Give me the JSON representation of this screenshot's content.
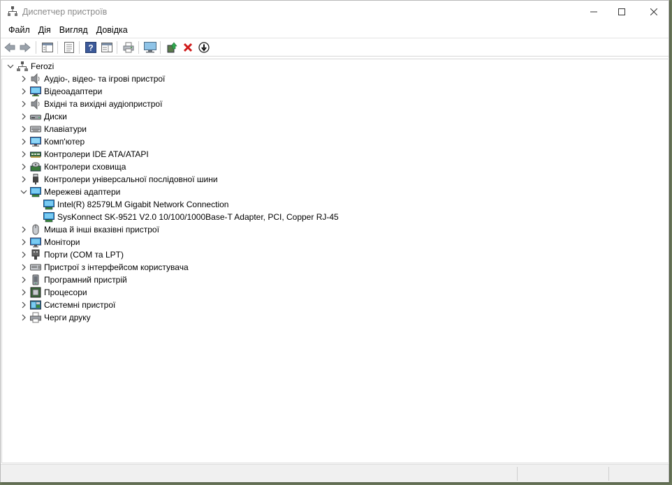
{
  "window": {
    "title": "Диспетчер пристроїв"
  },
  "menu": [
    {
      "label": "Файл"
    },
    {
      "label": "Дія"
    },
    {
      "label": "Вигляд"
    },
    {
      "label": "Довідка"
    }
  ],
  "tree": {
    "root": "Ferozi",
    "categories": [
      {
        "label": "Аудіо-, відео- та ігрові пристрої",
        "icon": "speaker-icon"
      },
      {
        "label": "Відеоадаптери",
        "icon": "display-adapter-icon"
      },
      {
        "label": "Вхідні та вихідні аудіопристрої",
        "icon": "speaker-icon"
      },
      {
        "label": "Диски",
        "icon": "disk-drive-icon"
      },
      {
        "label": "Клавіатури",
        "icon": "keyboard-icon"
      },
      {
        "label": "Комп'ютер",
        "icon": "computer-icon"
      },
      {
        "label": "Контролери IDE ATA/ATAPI",
        "icon": "ide-controller-icon"
      },
      {
        "label": "Контролери сховища",
        "icon": "storage-controller-icon"
      },
      {
        "label": "Контролери універсальної послідовної шини",
        "icon": "usb-icon"
      },
      {
        "label": "Мережеві адаптери",
        "icon": "network-adapter-icon",
        "expanded": true,
        "children": [
          {
            "label": "Intel(R) 82579LM Gigabit Network Connection",
            "icon": "network-adapter-icon"
          },
          {
            "label": "SysKonnect SK-9521 V2.0 10/100/1000Base-T Adapter, PCI, Copper RJ-45",
            "icon": "network-adapter-icon"
          }
        ]
      },
      {
        "label": "Миша й інші вказівні пристрої",
        "icon": "mouse-icon"
      },
      {
        "label": "Монітори",
        "icon": "monitor-icon"
      },
      {
        "label": "Порти (COM та LPT)",
        "icon": "port-icon"
      },
      {
        "label": "Пристрої з інтерфейсом користувача",
        "icon": "hid-icon"
      },
      {
        "label": "Програмний пристрій",
        "icon": "software-device-icon"
      },
      {
        "label": "Процесори",
        "icon": "processor-icon"
      },
      {
        "label": "Системні пристрої",
        "icon": "system-device-icon"
      },
      {
        "label": "Черги друку",
        "icon": "printer-icon"
      }
    ]
  }
}
